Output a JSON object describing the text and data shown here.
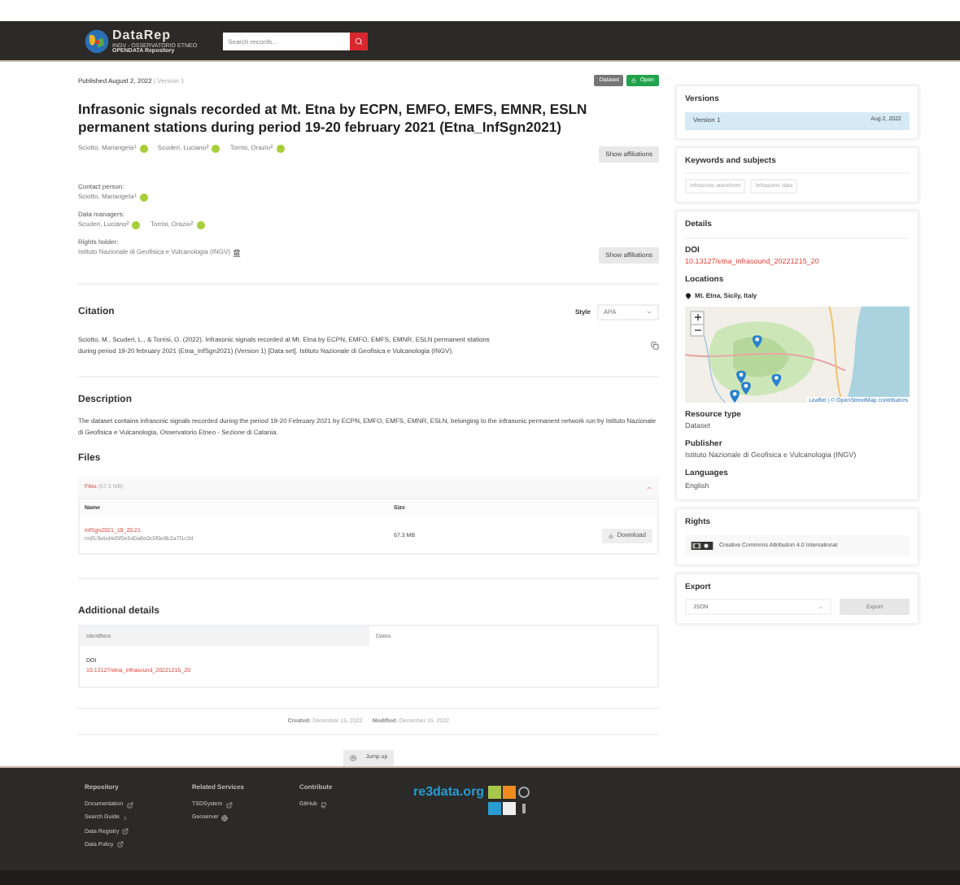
{
  "header": {
    "logo_title": "DataRep",
    "logo_subtitle": "INGV - OSSERVATORIO ETNEO",
    "logo_tagline": "OPENDATA Repository",
    "search_placeholder": "Search records..."
  },
  "record": {
    "published": "Published August 2, 2022",
    "separator": "|",
    "version": "Version 1",
    "badges": [
      {
        "label": "Dataset",
        "kind": "type"
      },
      {
        "label": "Open",
        "kind": "access"
      }
    ],
    "title": "Infrasonic signals recorded at Mt. Etna by ECPN, EMFO, EMFS, EMNR, ESLN permanent stations during period 19-20 february 2021 (Etna_InfSgn2021)",
    "creators": [
      {
        "name": "Sciotto, Mariangela$^{1}$",
        "kind": "person"
      },
      {
        "name": "Scuderi, Luciano$^{2}$",
        "kind": "person"
      },
      {
        "name": "Torrisi, Orazio$^{2}$",
        "kind": "person"
      }
    ],
    "show_affiliations": "Show affiliations",
    "roles": [
      {
        "label": "Contact person:",
        "people": [
          {
            "name": "Sciotto, Mariangela$^{1}$",
            "kind": "person"
          }
        ]
      },
      {
        "label": "Data managers:",
        "people": [
          {
            "name": "Scuderi, Luciano$^{2}$",
            "kind": "person"
          },
          {
            "name": "Torrisi, Orazio$^{2}$",
            "kind": "person"
          }
        ]
      },
      {
        "label": "Rights holder:",
        "people": [
          {
            "name": "Istituto Nazionale di Geofisica e Vulcanologia (INGV)",
            "kind": "org"
          }
        ]
      }
    ],
    "show_affiliations_2": "Show affiliations"
  },
  "citation": {
    "heading": "Citation",
    "style_label": "Style",
    "style_value": "APA",
    "text": "Sciotto, M., Scuderi, L., & Torrisi, O. (2022). Infrasonic signals recorded at Mt. Etna by ECPN, EMFO, EMFS, EMNR, ESLN permanent stations during period 19-20 february 2021 (Etna_InfSgn2021) (Version 1) [Data set]. Istituto Nazionale di Geofisica e Vulcanologia (INGV)."
  },
  "description": {
    "heading": "Description",
    "text": "The dataset contains infrasonic signals recorded during the period 19-20 February 2021 by ECPN, EMFO, EMFS, EMNR, ESLN, belonging to the infrasonic permanent network run by Istituto Nazionale di Geofisica e Vulcanologia, Osservatorio Etneo - Sezione di Catania."
  },
  "files": {
    "heading": "Files",
    "accordion_label": "Files",
    "accordion_size": "(67.3 MB)",
    "expanded": true,
    "columns": [
      "Name",
      "Size"
    ],
    "rows": [
      {
        "name": "InfSgn2021_19_20.21",
        "checksum": "md5:9ebd4d5f0e5d0a8e0c5f6e8b2a7f1c3d",
        "size": "67.3 MB",
        "action": "Download"
      }
    ]
  },
  "additional_details": {
    "heading": "Additional details",
    "tabs": [
      {
        "label": "Identifiers",
        "selected": true
      },
      {
        "label": "Dates",
        "selected": false
      }
    ],
    "doi_label": "DOI",
    "doi": "10.13127/etna_infrasound_20221215_20"
  },
  "dates": {
    "created_label": "Created:",
    "created": "December 15, 2022",
    "modified_label": "Modified:",
    "modified": "December 15, 2022"
  },
  "jump_up": "Jump up",
  "sidebar": {
    "versions": {
      "heading": "Versions",
      "items": [
        {
          "label": "Version 1",
          "date": "Aug 2, 2022",
          "selected": true
        }
      ]
    },
    "keywords": {
      "heading": "Keywords and subjects",
      "items": [
        "Infrasonic waveform",
        "Infrasonic data"
      ]
    },
    "details": {
      "heading": "Details",
      "doi_label": "DOI",
      "doi": "10.13127/etna_infrasound_20221215_20",
      "locations_label": "Locations",
      "location": "Mt. Etna, Sicily, Italy",
      "map_attribution": "Leaflet | © OpenStreetMap contributors",
      "resource_type_label": "Resource type",
      "resource_type": "Dataset",
      "publisher_label": "Publisher",
      "publisher": "Istituto Nazionale di Geofisica e Vulcanologia (INGV)",
      "languages_label": "Languages",
      "language": "English"
    },
    "rights": {
      "heading": "Rights",
      "license": "Creative Commons Attribution 4.0 International"
    },
    "export": {
      "heading": "Export",
      "format": "JSON",
      "button": "Export"
    }
  },
  "footer": {
    "columns": [
      {
        "heading": "Repository",
        "links": [
          {
            "label": "Documentation",
            "kind": "external"
          },
          {
            "label": "Search Guide",
            "kind": "internal"
          },
          {
            "label": "Data Registry",
            "kind": "external"
          },
          {
            "label": "Data Policy",
            "kind": "external"
          }
        ]
      },
      {
        "heading": "Related Services",
        "links": [
          {
            "label": "TSDSystem",
            "kind": "external"
          },
          {
            "label": "Geoserver",
            "kind": "geoserver"
          }
        ]
      },
      {
        "heading": "Contribute",
        "links": [
          {
            "label": "GitHub",
            "kind": "github"
          }
        ]
      }
    ],
    "badge_logo": "re3data.org"
  }
}
